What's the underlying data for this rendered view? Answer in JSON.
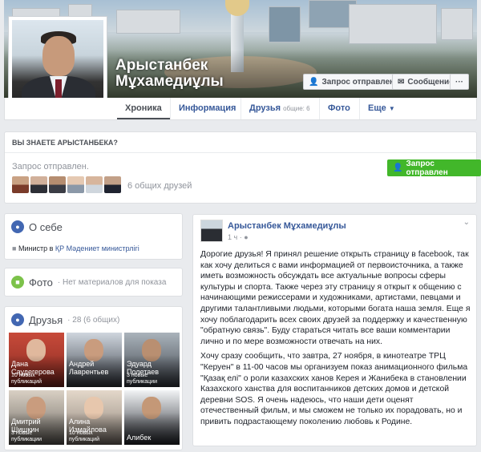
{
  "profile": {
    "name_line1": "Арыстанбек",
    "name_line2": "Мұхамедиұлы"
  },
  "cover_actions": {
    "request_sent": "Запрос отправлен",
    "message": "Сообщение",
    "more": "···"
  },
  "nav": {
    "timeline": "Хроника",
    "info": "Информация",
    "friends": "Друзья",
    "friends_common": "общие: 6",
    "photos": "Фото",
    "more": "Еще"
  },
  "know_card": {
    "title": "ВЫ ЗНАЕТЕ АРЫСТАНБЕКА?",
    "status": "Запрос отправлен.",
    "button": "Запрос отправлен",
    "mutual": "6 общих друзей",
    "accent": "#42b72a"
  },
  "about": {
    "title": "О себе",
    "job_prefix": "Министр в ",
    "job_link": "ҚР Мәдениет министрлігі"
  },
  "photos": {
    "title": "Фото",
    "empty": "· Нет материалов для показа"
  },
  "friends": {
    "title": "Друзья",
    "count": "· 28 (6 общих)",
    "items": [
      {
        "name_line1": "Дана",
        "name_line2": "Саудегерова",
        "pubs_line1": "10 новых",
        "pubs_line2": "публикаций"
      },
      {
        "name_line1": "Андрей",
        "name_line2": "Лаврентьев",
        "pubs_line1": "",
        "pubs_line2": ""
      },
      {
        "name_line1": "Эдуард",
        "name_line2": "Полетаев",
        "pubs_line1": "3 новые",
        "pubs_line2": "публикации"
      },
      {
        "name_line1": "Дмитрий",
        "name_line2": "Шишкин",
        "pubs_line1": "3 новые",
        "pubs_line2": "публикации"
      },
      {
        "name_line1": "Алина",
        "name_line2": "Измайлова",
        "pubs_line1": "10 новых",
        "pubs_line2": "публикаций"
      },
      {
        "name_line1": "Алибек",
        "name_line2": "",
        "pubs_line1": "",
        "pubs_line2": ""
      }
    ]
  },
  "post": {
    "author": "Арыстанбек Мұхамедиұлы",
    "time": "1 ч · ",
    "p1": "Дорогие друзья! Я принял решение открыть страницу в facebook, так как хочу делиться с вами информацией от первоисточника, а также иметь возможность обсуждать все актуальные вопросы сферы культуры и спорта. Также через эту страницу я открыт к общению с начинающими режиссерами и художниками, артистами, певцами и другими талантливыми людьми, которыми богата наша земля. Еще я хочу поблагодарить всех своих друзей за поддержку и качественную \"обратную связь\". Буду стараться читать все ваши комментарии лично и по мере возможности отвечать на них.",
    "p2": "Хочу сразу сообщить, что завтра, 27 ноября, в кинотеатре ТРЦ \"Керуен\" в 11-00 часов мы организуем показ анимационного фильма \"Қазақ елі\" о роли казахских ханов Керея и Жанибека в становлении Казахского ханства для воспитанников детских домов и детской деревни SOS. Я очень надеюсь, что наши дети оценят отечественный фильм, и мы сможем не только их порадовать, но и привить подрастающему поколению любовь к Родине."
  }
}
